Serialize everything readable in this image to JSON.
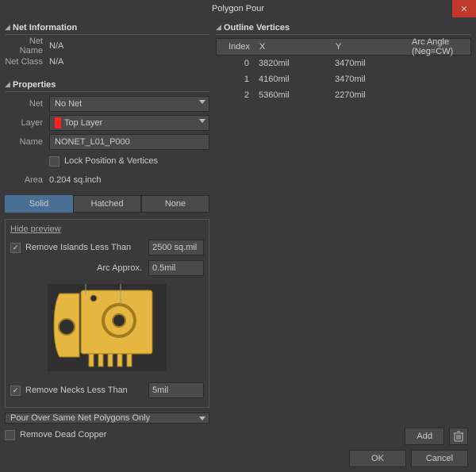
{
  "title": "Polygon Pour",
  "net_information": {
    "header": "Net Information",
    "rows": [
      {
        "k": "Net Name",
        "v": "N/A"
      },
      {
        "k": "Net Class",
        "v": "N/A"
      }
    ]
  },
  "properties": {
    "header": "Properties",
    "net_label": "Net",
    "net_value": "No Net",
    "layer_label": "Layer",
    "layer_value": "Top Layer",
    "layer_color": "#ff2020",
    "name_label": "Name",
    "name_value": "NONET_L01_P000",
    "lock_label": "Lock Position & Vertices",
    "lock_checked": false,
    "area_label": "Area",
    "area_value": "0.204 sq.inch",
    "fill_mode": {
      "options": [
        "Solid",
        "Hatched",
        "None"
      ],
      "active": "Solid"
    },
    "hide_preview": "Hide preview",
    "remove_islands_label": "Remove Islands Less Than",
    "remove_islands_checked": true,
    "remove_islands_value": "2500 sq.mil",
    "arc_approx_label": "Arc Approx.",
    "arc_approx_value": "0.5mil",
    "remove_necks_label": "Remove Necks Less Than",
    "remove_necks_checked": true,
    "remove_necks_value": "5mil",
    "pour_over_label": "Pour Over Same Net Polygons Only",
    "remove_dead_label": "Remove Dead Copper",
    "remove_dead_checked": false
  },
  "outline": {
    "header": "Outline Vertices",
    "columns": {
      "index": "Index",
      "x": "X",
      "y": "Y",
      "arc": "Arc Angle (Neg=CW)"
    },
    "rows": [
      {
        "index": "0",
        "x": "3820mil",
        "y": "3470mil",
        "arc": ""
      },
      {
        "index": "1",
        "x": "4160mil",
        "y": "3470mil",
        "arc": ""
      },
      {
        "index": "2",
        "x": "5360mil",
        "y": "2270mil",
        "arc": ""
      }
    ],
    "add_label": "Add"
  },
  "buttons": {
    "ok": "OK",
    "cancel": "Cancel"
  },
  "icons": {
    "trash": "trash-icon",
    "close": "close-icon"
  }
}
